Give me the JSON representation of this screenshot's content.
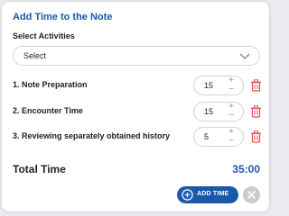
{
  "dialog": {
    "title": "Add Time to the Note",
    "select_label": "Select Activities",
    "select_value": "Select"
  },
  "activities": [
    {
      "label": "1. Note Preparation",
      "minutes": "15"
    },
    {
      "label": "2. Encounter Time",
      "minutes": "15"
    },
    {
      "label": "3. Reviewing separately obtained history",
      "minutes": "5"
    }
  ],
  "stepper": {
    "plus": "+",
    "minus": "−"
  },
  "total": {
    "label": "Total Time",
    "value": "35:00"
  },
  "footer": {
    "add_label": "ADD TIME"
  },
  "icons": {
    "chevron": "chevron-down-icon",
    "trash": "trash-icon",
    "add": "plus-circle-icon",
    "close": "close-icon"
  },
  "colors": {
    "accent": "#1b58a8",
    "delete": "#e05050",
    "close_bg": "#c9cbcf"
  }
}
